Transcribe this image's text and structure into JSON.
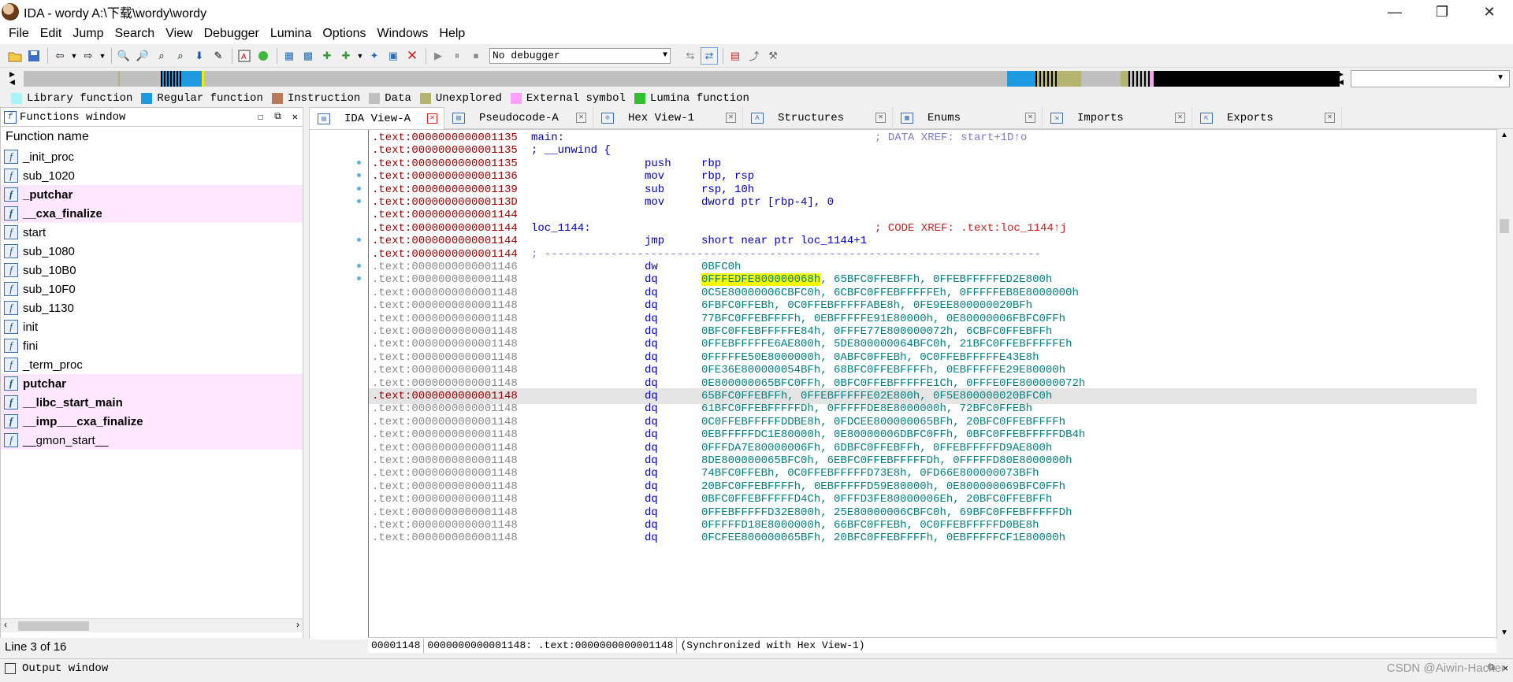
{
  "window": {
    "title": "IDA - wordy A:\\下载\\wordy\\wordy",
    "minimize": "—",
    "restore": "❐",
    "close": "✕"
  },
  "menu": [
    "File",
    "Edit",
    "Jump",
    "Search",
    "View",
    "Debugger",
    "Lumina",
    "Options",
    "Windows",
    "Help"
  ],
  "toolbar": {
    "debugger_select": "No debugger"
  },
  "legend": [
    {
      "label": "Library function",
      "color": "#a8f4f8"
    },
    {
      "label": "Regular function",
      "color": "#1e9ae0"
    },
    {
      "label": "Instruction",
      "color": "#b87a58"
    },
    {
      "label": "Data",
      "color": "#c0c0c0"
    },
    {
      "label": "Unexplored",
      "color": "#b4b46e"
    },
    {
      "label": "External symbol",
      "color": "#ffa0ff"
    },
    {
      "label": "Lumina function",
      "color": "#30c030"
    }
  ],
  "functions_window": {
    "title": "Functions window",
    "column": "Function name",
    "items": [
      {
        "name": "_init_proc",
        "bold": false,
        "ext": false
      },
      {
        "name": "sub_1020",
        "bold": false,
        "ext": false
      },
      {
        "name": "_putchar",
        "bold": true,
        "ext": true
      },
      {
        "name": "__cxa_finalize",
        "bold": true,
        "ext": true
      },
      {
        "name": "start",
        "bold": false,
        "ext": false
      },
      {
        "name": "sub_1080",
        "bold": false,
        "ext": false
      },
      {
        "name": "sub_10B0",
        "bold": false,
        "ext": false
      },
      {
        "name": "sub_10F0",
        "bold": false,
        "ext": false
      },
      {
        "name": "sub_1130",
        "bold": false,
        "ext": false
      },
      {
        "name": "init",
        "bold": false,
        "ext": false
      },
      {
        "name": "fini",
        "bold": false,
        "ext": false
      },
      {
        "name": "_term_proc",
        "bold": false,
        "ext": false
      },
      {
        "name": "putchar",
        "bold": true,
        "ext": true
      },
      {
        "name": "__libc_start_main",
        "bold": true,
        "ext": true
      },
      {
        "name": "__imp___cxa_finalize",
        "bold": true,
        "ext": true
      },
      {
        "name": "__gmon_start__",
        "bold": false,
        "ext": true
      }
    ],
    "status": "Line 3 of 16"
  },
  "tabs": [
    {
      "label": "IDA View-A",
      "icon": "ida-view-icon",
      "active": true
    },
    {
      "label": "Pseudocode-A",
      "icon": "pseudocode-icon",
      "active": false
    },
    {
      "label": "Hex View-1",
      "icon": "hex-icon",
      "active": false
    },
    {
      "label": "Structures",
      "icon": "structures-icon",
      "active": false
    },
    {
      "label": "Enums",
      "icon": "enums-icon",
      "active": false
    },
    {
      "label": "Imports",
      "icon": "imports-icon",
      "active": false
    },
    {
      "label": "Exports",
      "icon": "exports-icon",
      "active": false
    }
  ],
  "disassembly": {
    "lines": [
      {
        "addr": ".text:0000000000001135",
        "code": true,
        "label": "main:",
        "mn": "",
        "ops": "",
        "comment": "; DATA XREF: start+1D↑o",
        "ctype": "blue",
        "dot": false
      },
      {
        "addr": ".text:0000000000001135",
        "code": true,
        "label": "; __unwind {",
        "mn": "",
        "ops": "",
        "comment": "",
        "ctype": "",
        "dot": false
      },
      {
        "addr": ".text:0000000000001135",
        "code": true,
        "label": "",
        "mn": "push",
        "ops": "rbp",
        "comment": "",
        "ctype": "",
        "dot": true
      },
      {
        "addr": ".text:0000000000001136",
        "code": true,
        "label": "",
        "mn": "mov",
        "ops": "rbp, rsp",
        "comment": "",
        "ctype": "",
        "dot": true
      },
      {
        "addr": ".text:0000000000001139",
        "code": true,
        "label": "",
        "mn": "sub",
        "ops": "rsp, 10h",
        "comment": "",
        "ctype": "",
        "dot": true
      },
      {
        "addr": ".text:000000000000113D",
        "code": true,
        "label": "",
        "mn": "mov",
        "ops": "dword ptr [rbp-4], 0",
        "comment": "",
        "ctype": "",
        "dot": true
      },
      {
        "addr": ".text:0000000000001144",
        "code": true,
        "label": "",
        "mn": "",
        "ops": "",
        "comment": "",
        "ctype": "",
        "dot": false
      },
      {
        "addr": ".text:0000000000001144",
        "code": true,
        "label": "loc_1144:",
        "mn": "",
        "ops": "",
        "comment": "; CODE XREF: .text:loc_1144↑j",
        "ctype": "red",
        "dot": false
      },
      {
        "addr": ".text:0000000000001144",
        "code": true,
        "label": "",
        "mn": "jmp",
        "ops": "short near ptr loc_1144+1",
        "comment": "",
        "ctype": "",
        "dot": true
      },
      {
        "addr": ".text:0000000000001144",
        "code": true,
        "label": "; ---------------------------------------------------------------------------",
        "mn": "",
        "ops": "",
        "comment": "",
        "ctype": "sep",
        "dot": false
      },
      {
        "addr": ".text:0000000000001146",
        "code": false,
        "label": "",
        "mn": "dw",
        "ops": "0BFC0h",
        "comment": "",
        "ctype": "",
        "dot": true
      },
      {
        "addr": ".text:0000000000001148",
        "code": false,
        "label": "",
        "mn": "dq",
        "ops_hl": "0FFFEDFE800000068h",
        "ops": ", 65BFC0FFEBFFh, 0FFEBFFFFFED2E800h",
        "comment": "",
        "ctype": "",
        "dot": true
      },
      {
        "addr": ".text:0000000000001148",
        "code": false,
        "label": "",
        "mn": "dq",
        "ops": "0C5E80000006CBFC0h, 6CBFC0FFEBFFFFFEh, 0FFFFFEB8E8000000h",
        "comment": "",
        "ctype": "",
        "dot": false
      },
      {
        "addr": ".text:0000000000001148",
        "code": false,
        "label": "",
        "mn": "dq",
        "ops": "6FBFC0FFEBh, 0C0FFEBFFFFFABE8h, 0FE9EE800000020BFh",
        "comment": "",
        "ctype": "",
        "dot": false
      },
      {
        "addr": ".text:0000000000001148",
        "code": false,
        "label": "",
        "mn": "dq",
        "ops": "77BFC0FFEBFFFFh, 0EBFFFFFE91E80000h, 0E80000006FBFC0FFh",
        "comment": "",
        "ctype": "",
        "dot": false
      },
      {
        "addr": ".text:0000000000001148",
        "code": false,
        "label": "",
        "mn": "dq",
        "ops": "0BFC0FFEBFFFFFE84h, 0FFFE77E800000072h, 6CBFC0FFEBFFh",
        "comment": "",
        "ctype": "",
        "dot": false
      },
      {
        "addr": ".text:0000000000001148",
        "code": false,
        "label": "",
        "mn": "dq",
        "ops": "0FFEBFFFFFE6AE800h, 5DE800000064BFC0h, 21BFC0FFEBFFFFFEh",
        "comment": "",
        "ctype": "",
        "dot": false
      },
      {
        "addr": ".text:0000000000001148",
        "code": false,
        "label": "",
        "mn": "dq",
        "ops": "0FFFFFE50E8000000h, 0ABFC0FFEBh, 0C0FFEBFFFFFE43E8h",
        "comment": "",
        "ctype": "",
        "dot": false
      },
      {
        "addr": ".text:0000000000001148",
        "code": false,
        "label": "",
        "mn": "dq",
        "ops": "0FE36E800000054BFh, 68BFC0FFEBFFFFh, 0EBFFFFFE29E80000h",
        "comment": "",
        "ctype": "",
        "dot": false
      },
      {
        "addr": ".text:0000000000001148",
        "code": false,
        "label": "",
        "mn": "dq",
        "ops": "0E800000065BFC0FFh, 0BFC0FFEBFFFFFE1Ch, 0FFFE0FE800000072h",
        "comment": "",
        "ctype": "",
        "dot": false
      },
      {
        "addr": ".text:0000000000001148",
        "code": true,
        "hl": true,
        "label": "",
        "mn": "dq",
        "ops": "65BFC0FFEBFFh, 0FFEBFFFFFE02E800h, 0F5E800000020BFC0h",
        "comment": "",
        "ctype": "",
        "dot": false
      },
      {
        "addr": ".text:0000000000001148",
        "code": false,
        "label": "",
        "mn": "dq",
        "ops": "61BFC0FFEBFFFFFDh, 0FFFFFDE8E8000000h, 72BFC0FFEBh",
        "comment": "",
        "ctype": "",
        "dot": false
      },
      {
        "addr": ".text:0000000000001148",
        "code": false,
        "label": "",
        "mn": "dq",
        "ops": "0C0FFEBFFFFFDDBE8h, 0FDCEE800000065BFh, 20BFC0FFEBFFFFh",
        "comment": "",
        "ctype": "",
        "dot": false
      },
      {
        "addr": ".text:0000000000001148",
        "code": false,
        "label": "",
        "mn": "dq",
        "ops": "0EBFFFFFDC1E80000h, 0E80000006DBFC0FFh, 0BFC0FFEBFFFFFDB4h",
        "comment": "",
        "ctype": "",
        "dot": false
      },
      {
        "addr": ".text:0000000000001148",
        "code": false,
        "label": "",
        "mn": "dq",
        "ops": "0FFFDA7E80000006Fh, 6DBFC0FFEBFFh, 0FFEBFFFFFD9AE800h",
        "comment": "",
        "ctype": "",
        "dot": false
      },
      {
        "addr": ".text:0000000000001148",
        "code": false,
        "label": "",
        "mn": "dq",
        "ops": "8DE800000065BFC0h, 6EBFC0FFEBFFFFFDh, 0FFFFFD80E8000000h",
        "comment": "",
        "ctype": "",
        "dot": false
      },
      {
        "addr": ".text:0000000000001148",
        "code": false,
        "label": "",
        "mn": "dq",
        "ops": "74BFC0FFEBh, 0C0FFEBFFFFFD73E8h, 0FD66E800000073BFh",
        "comment": "",
        "ctype": "",
        "dot": false
      },
      {
        "addr": ".text:0000000000001148",
        "code": false,
        "label": "",
        "mn": "dq",
        "ops": "20BFC0FFEBFFFFh, 0EBFFFFFD59E80000h, 0E800000069BFC0FFh",
        "comment": "",
        "ctype": "",
        "dot": false
      },
      {
        "addr": ".text:0000000000001148",
        "code": false,
        "label": "",
        "mn": "dq",
        "ops": "0BFC0FFEBFFFFFD4Ch, 0FFFD3FE80000006Eh, 20BFC0FFEBFFh",
        "comment": "",
        "ctype": "",
        "dot": false
      },
      {
        "addr": ".text:0000000000001148",
        "code": false,
        "label": "",
        "mn": "dq",
        "ops": "0FFEBFFFFFD32E800h, 25E80000006CBFC0h, 69BFC0FFEBFFFFFDh",
        "comment": "",
        "ctype": "",
        "dot": false
      },
      {
        "addr": ".text:0000000000001148",
        "code": false,
        "label": "",
        "mn": "dq",
        "ops": "0FFFFFD18E8000000h, 66BFC0FFEBh, 0C0FFEBFFFFFD0BE8h",
        "comment": "",
        "ctype": "",
        "dot": false
      },
      {
        "addr": ".text:0000000000001148",
        "code": false,
        "label": "",
        "mn": "dq",
        "ops": "0FCFEE800000065BFh, 20BFC0FFEBFFFFh, 0EBFFFFFCF1E80000h",
        "comment": "",
        "ctype": "",
        "dot": false
      }
    ],
    "status": {
      "offset": "00001148",
      "location": "0000000000001148: .text:0000000000001148",
      "sync": "(Synchronized with Hex View-1)"
    }
  },
  "output_window": {
    "title": "Output window"
  },
  "watermark": "CSDN @Aiwin-Hacker"
}
